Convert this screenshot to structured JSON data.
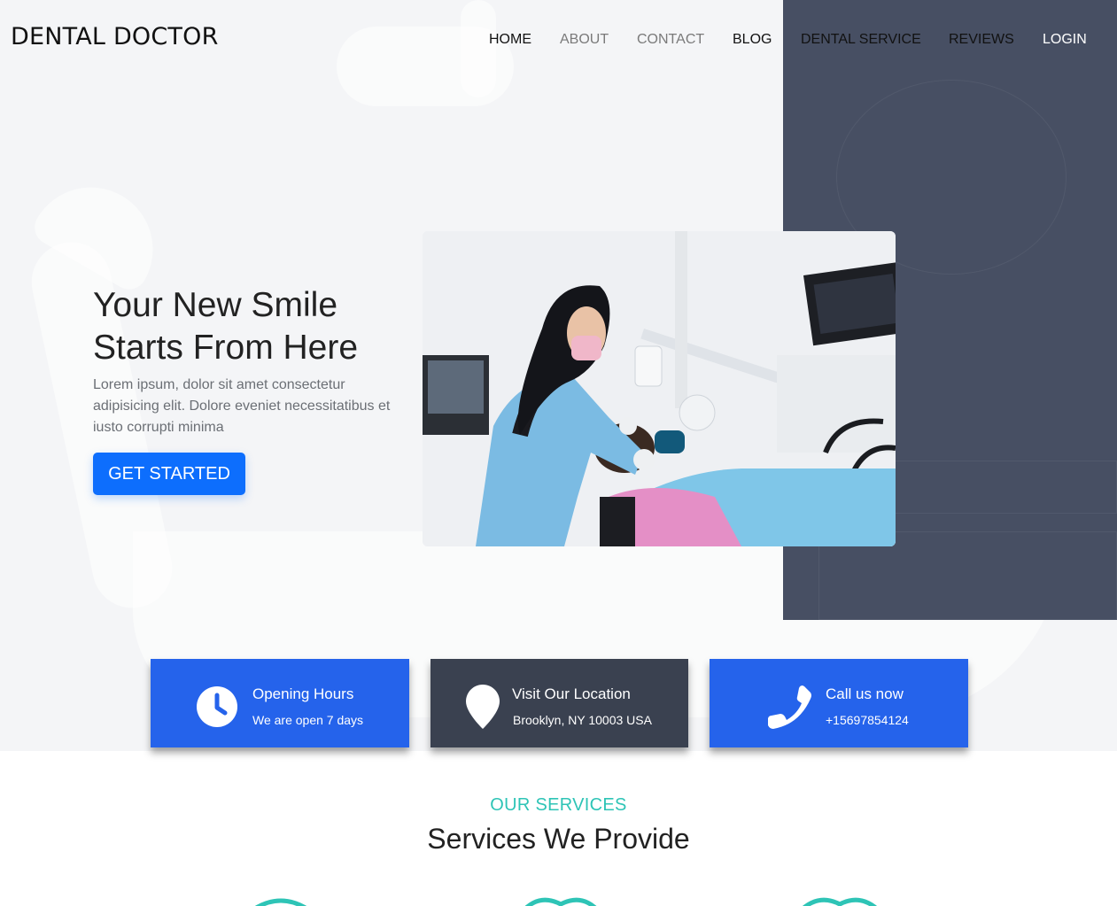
{
  "site": {
    "logo": "DENTAL DOCTOR"
  },
  "nav": {
    "items": [
      {
        "label": "HOME",
        "color": "#111111"
      },
      {
        "label": "ABOUT",
        "color": "#7a7a7a"
      },
      {
        "label": "CONTACT",
        "color": "#7a7a7a"
      },
      {
        "label": "BLOG",
        "color": "#111111"
      },
      {
        "label": "DENTAL SERVICE",
        "color": "#111111"
      },
      {
        "label": "REVIEWS",
        "color": "#111111"
      },
      {
        "label": "LOGIN",
        "color": "#ffffff"
      }
    ]
  },
  "hero": {
    "title": "Your New Smile Starts From Here",
    "description": "Lorem ipsum, dolor sit amet consectetur adipisicing elit. Dolore eveniet necessitatibus et iusto corrupti minima",
    "cta_label": "GET STARTED"
  },
  "info": [
    {
      "icon": "clock-icon",
      "title": "Opening Hours",
      "subtitle": "We are open 7 days",
      "bg": "#2563eb"
    },
    {
      "icon": "location-pin-icon",
      "title": "Visit Our Location",
      "subtitle": "Brooklyn, NY 10003 USA",
      "bg": "#3a4150"
    },
    {
      "icon": "phone-icon",
      "title": "Call us now",
      "subtitle": "+15697854124",
      "bg": "#2563eb"
    }
  ],
  "services": {
    "kicker": "OUR SERVICES",
    "title": "Services We Provide"
  },
  "colors": {
    "accent_blue": "#2563eb",
    "button_blue": "#0d6efd",
    "dark_panel": "#474f63",
    "teal": "#2ec4b6"
  }
}
